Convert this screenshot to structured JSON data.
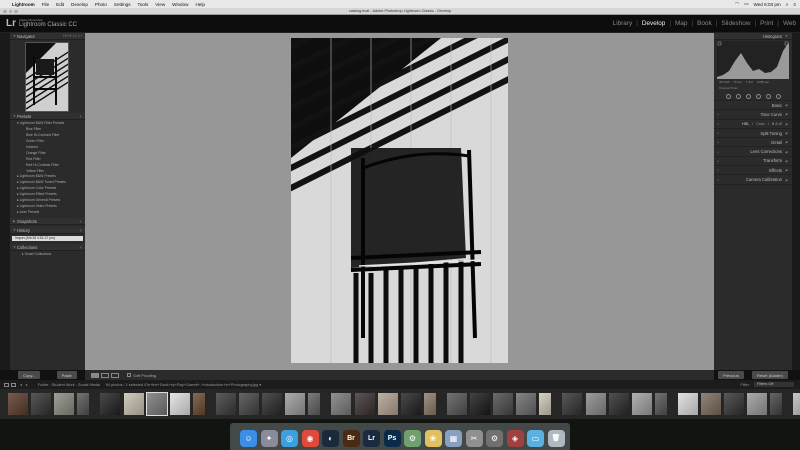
{
  "menubar": {
    "items": [
      "Lightroom",
      "File",
      "Edit",
      "Develop",
      "Photo",
      "Settings",
      "Tools",
      "View",
      "Window",
      "Help"
    ],
    "clock": "Wed 6:03 pm"
  },
  "titlebar": {
    "title": "catalog.lrcat - Adobe Photoshop Lightroom Classic - Develop"
  },
  "identity": {
    "logo": "Lr",
    "brand_small": "Adobe Photoshop",
    "brand_main": "Lightroom Classic CC"
  },
  "modules": [
    "Library",
    "Develop",
    "Map",
    "Book",
    "Slideshow",
    "Print",
    "Web"
  ],
  "left_panel": {
    "navigator": {
      "title": "Navigator",
      "options": "Fit  Fill  1:1  3:1"
    },
    "presets": {
      "title": "Presets",
      "tree": [
        {
          "kind": "folder",
          "label": "▾ Lightroom B&W Filter Presets"
        },
        {
          "kind": "child",
          "label": "Blue Filter"
        },
        {
          "kind": "child",
          "label": "Blue Hi-Contrast Filter"
        },
        {
          "kind": "child",
          "label": "Green Filter"
        },
        {
          "kind": "child",
          "label": "Infrared"
        },
        {
          "kind": "child",
          "label": "Orange Filter"
        },
        {
          "kind": "child",
          "label": "Red Filter"
        },
        {
          "kind": "child",
          "label": "Red Hi-Contrast Filter"
        },
        {
          "kind": "child",
          "label": "Yellow Filter"
        },
        {
          "kind": "folder",
          "label": "▸ Lightroom B&W Presets"
        },
        {
          "kind": "folder",
          "label": "▸ Lightroom B&W Toned Presets"
        },
        {
          "kind": "folder",
          "label": "▸ Lightroom Color Presets"
        },
        {
          "kind": "folder",
          "label": "▸ Lightroom Effect Presets"
        },
        {
          "kind": "folder",
          "label": "▸ Lightroom General Presets"
        },
        {
          "kind": "folder",
          "label": "▸ Lightroom Video Presets"
        },
        {
          "kind": "folder",
          "label": "▸ User Presets"
        }
      ]
    },
    "snapshots": {
      "title": "Snapshots"
    },
    "history": {
      "title": "History",
      "entry": "Import (8/4/18 4:51:27 pm)"
    },
    "collections": {
      "title": "Collections",
      "entry": "▸ Smart Collections"
    },
    "copy_label": "Copy...",
    "paste_label": "Paste"
  },
  "right_panel": {
    "histogram_title": "Histogram",
    "histogram_stats": [
      "ISO 200",
      "70 mm",
      "f / 8.0",
      "1/250 sec"
    ],
    "histogram_caption": "Original Photo",
    "sections": [
      "Basic",
      "Tone Curve"
    ],
    "hsl": {
      "hsl": "HSL",
      "color": "Color",
      "bw": "B & W"
    },
    "sections_rest": [
      "Split Toning",
      "Detail",
      "Lens Corrections",
      "Transform",
      "Effects",
      "Camera Calibration"
    ],
    "previous_label": "Previous",
    "reset_label": "Reset (Adobe)"
  },
  "toolbar": {
    "soft_proofing": "Soft Proofing"
  },
  "filmstrip": {
    "folder": "Folder : Student Work - Social Media",
    "count": "94 photos / 1 selected /On+the+Deck+by+Ray+Garrett+-+Introduction+to+Photography.jpg ▾",
    "filter_label": "Filter :",
    "filter_value": "Filters Off",
    "thumbs": [
      {
        "tone": "#5a3a2a"
      },
      {
        "tone": "#333"
      },
      {
        "tone": "#8a8a80"
      },
      {
        "tone": "#555"
      },
      {
        "tone": "#222"
      },
      {
        "tone": "#c8c0b0"
      },
      {
        "tone": "#777"
      },
      {
        "tone": "#e0e0e0"
      },
      {
        "tone": "#6a4a30"
      },
      {
        "tone": "#3a3a3a"
      },
      {
        "tone": "#444"
      },
      {
        "tone": "#2a2a2a"
      },
      {
        "tone": "#9a9a9a"
      },
      {
        "tone": "#606060"
      },
      {
        "tone": "#7a7a7a"
      },
      {
        "tone": "#3a3030"
      },
      {
        "tone": "#b0a090"
      },
      {
        "tone": "#222"
      },
      {
        "tone": "#8a7a6a"
      },
      {
        "tone": "#555"
      },
      {
        "tone": "#1a1a1a"
      },
      {
        "tone": "#4a4a4a"
      },
      {
        "tone": "#6a6a6a"
      },
      {
        "tone": "#d0c8b8"
      },
      {
        "tone": "#333"
      },
      {
        "tone": "#888"
      },
      {
        "tone": "#2a2a2a"
      },
      {
        "tone": "#a0a0a0"
      },
      {
        "tone": "#555"
      },
      {
        "tone": "#ddd"
      },
      {
        "tone": "#7a6a5a"
      },
      {
        "tone": "#333"
      },
      {
        "tone": "#999"
      },
      {
        "tone": "#444"
      },
      {
        "tone": "#bbb"
      },
      {
        "tone": "#222"
      },
      {
        "tone": "#cfcfcf"
      },
      {
        "tone": "#6a6a6a"
      },
      {
        "tone": "#8a6a4a"
      },
      {
        "tone": "#333"
      }
    ],
    "selected_index": 6
  },
  "dock": {
    "icons": [
      {
        "name": "finder-icon",
        "glyph": "☺",
        "color": "#3a8ee6"
      },
      {
        "name": "launchpad-icon",
        "glyph": "✦",
        "color": "#8a8a9a"
      },
      {
        "name": "safari-icon",
        "glyph": "◎",
        "color": "#3aa0e0"
      },
      {
        "name": "chrome-icon",
        "glyph": "◉",
        "color": "#e04a3a"
      },
      {
        "name": "steam-icon",
        "glyph": "◐",
        "color": "#1a2a3a"
      },
      {
        "name": "bridge-icon",
        "glyph": "Br",
        "color": "#4a2a10"
      },
      {
        "name": "lightroom-icon",
        "glyph": "Lr",
        "color": "#1a2a40"
      },
      {
        "name": "photoshop-icon",
        "glyph": "Ps",
        "color": "#0a2a4a"
      },
      {
        "name": "system-prefs-icon",
        "glyph": "⚙",
        "color": "#70a070"
      },
      {
        "name": "photos-icon",
        "glyph": "❀",
        "color": "#e0c060"
      },
      {
        "name": "preview-icon",
        "glyph": "▦",
        "color": "#8aa0c0"
      },
      {
        "name": "utilities-icon",
        "glyph": "✂",
        "color": "#909090"
      },
      {
        "name": "settings-icon",
        "glyph": "⚙",
        "color": "#707070"
      },
      {
        "name": "maps-icon",
        "glyph": "◈",
        "color": "#a04040"
      },
      {
        "name": "folder-icon",
        "glyph": "▭",
        "color": "#5ab0e0"
      },
      {
        "name": "trash-icon",
        "glyph": "🗑",
        "color": "#b0b8c0"
      }
    ]
  },
  "colors": {
    "canvas": "#979797",
    "panel": "#2b2b2b",
    "active_module": "#eeeeee"
  }
}
